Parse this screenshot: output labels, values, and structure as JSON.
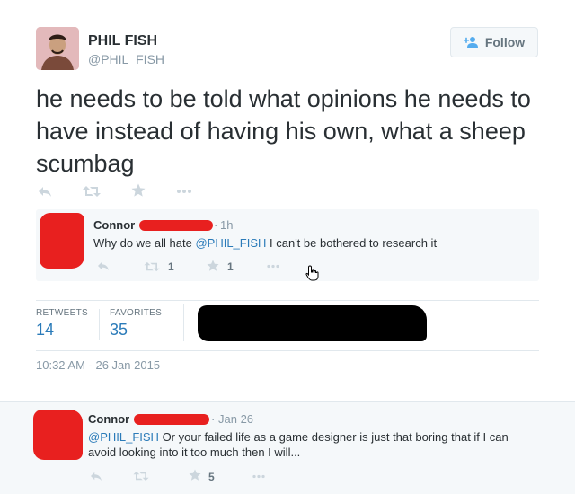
{
  "tweet": {
    "author_name": "PHIL FISH",
    "author_handle": "@PHIL_FISH",
    "text": "he needs to be told what opinions he needs to have instead of having his own, what a sheep scumbag",
    "follow_label": "Follow",
    "timestamp": "10:32 AM - 26 Jan 2015"
  },
  "quoted_reply": {
    "name": "Connor",
    "time": "1h",
    "text_before": "Why do we all hate ",
    "mention": "@PHIL_FISH",
    "text_after": " I can't be bothered to research it",
    "retweets": "1",
    "favorites": "1"
  },
  "stats": {
    "retweets_label": "RETWEETS",
    "retweets_value": "14",
    "favorites_label": "FAVORITES",
    "favorites_value": "35"
  },
  "bottom_reply": {
    "name": "Connor",
    "time": "Jan 26",
    "mention": "@PHIL_FISH",
    "text_after": " Or your failed life as a game designer is just that boring that if I can avoid looking into it too much then I will...",
    "favorites": "5"
  },
  "colors": {
    "link": "#2b7bb9",
    "redaction_red": "#e8201f",
    "muted": "#8899a6",
    "icon": "#ccd6dd"
  }
}
